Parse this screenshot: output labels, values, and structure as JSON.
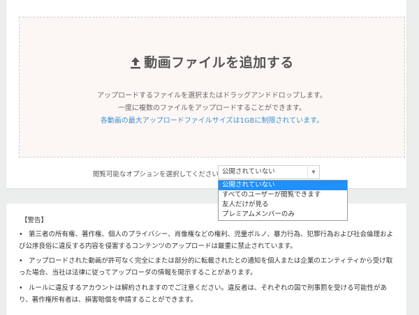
{
  "upload": {
    "title": "動画ファイルを追加する",
    "instruction": "アップロードするファイルを選択またはドラッグアンドドロップします。",
    "multi": "一度に複数のファイルをアップロードすることができます。",
    "limit": "各動画の最大アップロードファイルサイズは1GBに制限されています。",
    "limit_color": "#3a8fd6",
    "bg_color": "#fcf7f4",
    "icon": "upload-arrow-icon"
  },
  "visibility": {
    "label": "閲覧可能なオプションを選択してください：",
    "selected": "公開されていない",
    "options": [
      "公開されていない",
      "すべてのユーザーが閲覧できます",
      "友人だけが見る",
      "プレミアムメンバーのみ"
    ],
    "highlight_color": "#1e90ff"
  },
  "notice": {
    "heading": "【警告】",
    "items": [
      "第三者の所有権、著作権、個人のプライバシー、肖像権などの権利、児童ポルノ、暴力行為、犯罪行為および社会倫理および公序良俗に違反する内容を侵害するコンテンツのアップロードは厳重に禁止されています。",
      "アップロードされた動画が許可なく完全にまたは部分的に転載されたとの通知を個人または企業のエンティティから受け取った場合、当社は法律に従ってアップローダの情報を開示することがあります。",
      "ルールに違反するアカウントは解約されますのでご注意ください。違反者は、それぞれの国で刑事罰を受ける可能性があり、著作権所有者は、損害賠償を申請することができます。"
    ]
  }
}
